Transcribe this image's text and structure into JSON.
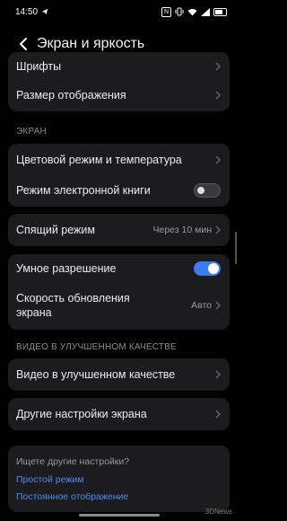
{
  "status_bar": {
    "time": "14:50"
  },
  "header": {
    "title": "Экран и яркость"
  },
  "rows": {
    "fonts": "Шрифты",
    "display_size": "Размер отображения",
    "color_mode": "Цветовой режим и температура",
    "ebook_mode": "Режим электронной книги",
    "sleep": "Спящий режим",
    "sleep_value": "Через 10 мин",
    "smart_resolution": "Умное разрешение",
    "refresh_rate": "Скорость обновления экрана",
    "refresh_rate_value": "Авто",
    "enhanced_video": "Видео в улучшенном качестве",
    "other_settings": "Другие настройки экрана"
  },
  "toggles": {
    "ebook_mode_on": false,
    "smart_resolution_on": true
  },
  "sections": {
    "screen": "ЭКРАН",
    "video": "ВИДЕО В УЛУЧШЕННОМ КАЧЕСТВЕ"
  },
  "links": {
    "hint": "Ищете другие настройки?",
    "simple_mode": "Простой режим",
    "always_on": "Постоянное отображение"
  },
  "watermark": "3DNews",
  "colors": {
    "accent": "#3d7bf0",
    "link": "#4d8cf5",
    "card": "#1c1c1e"
  }
}
